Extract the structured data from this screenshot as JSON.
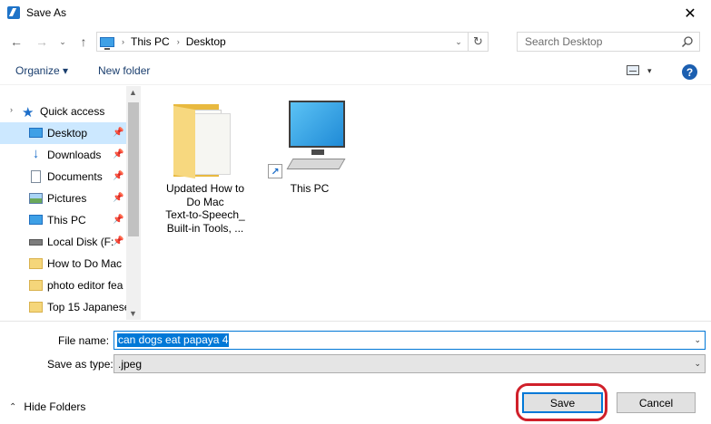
{
  "window": {
    "title": "Save As",
    "close_glyph": "✕"
  },
  "navigation": {
    "back_glyph": "←",
    "forward_glyph": "→",
    "recent_glyph": "⌄",
    "up_glyph": "↑",
    "breadcrumb_sep_glyph": "›",
    "breadcrumb": [
      "This PC",
      "Desktop"
    ],
    "address_dropdown_glyph": "⌄",
    "refresh_glyph": "↻",
    "search_placeholder": "Search Desktop"
  },
  "toolbar": {
    "organize_label": "Organize ▾",
    "new_folder_label": "New folder",
    "view_dropdown_glyph": "▾",
    "help_glyph": "?"
  },
  "nav_pane": {
    "quick_access_label": "Quick access",
    "expand_glyph": "›",
    "star_glyph": "★",
    "pin_glyph": "📌",
    "items": [
      {
        "label": "Desktop",
        "icon": "desktop-icon",
        "pinned": true,
        "selected": true
      },
      {
        "label": "Downloads",
        "icon": "downloads-icon",
        "pinned": true,
        "selected": false
      },
      {
        "label": "Documents",
        "icon": "documents-icon",
        "pinned": true,
        "selected": false
      },
      {
        "label": "Pictures",
        "icon": "pictures-icon",
        "pinned": true,
        "selected": false
      },
      {
        "label": "This PC",
        "icon": "this-pc-icon",
        "pinned": true,
        "selected": false
      },
      {
        "label": "Local Disk (F:",
        "icon": "local-disk-icon",
        "pinned": true,
        "selected": false
      },
      {
        "label": "How to Do Mac",
        "icon": "folder-icon",
        "pinned": false,
        "selected": false
      },
      {
        "label": "photo editor fea",
        "icon": "folder-icon",
        "pinned": false,
        "selected": false
      },
      {
        "label": "Top 15 Japanese",
        "icon": "folder-icon",
        "pinned": false,
        "selected": false
      }
    ],
    "scroll_up_glyph": "▲",
    "scroll_down_glyph": "▼"
  },
  "files": [
    {
      "label_lines": [
        "Updated How to",
        "Do Mac",
        "Text-to-Speech_",
        "Built-in Tools, ..."
      ],
      "icon": "folder-icon"
    },
    {
      "label_lines": [
        "This PC"
      ],
      "icon": "this-pc-shortcut-icon"
    }
  ],
  "form": {
    "file_name_label": "File name:",
    "file_name_value": "can dogs eat papaya 4",
    "save_as_type_label": "Save as type:",
    "save_as_type_value": ".jpeg",
    "dropdown_glyph": "⌄"
  },
  "footer": {
    "hide_folders_glyph": "⌃",
    "hide_folders_label": "Hide Folders",
    "save_label": "Save",
    "cancel_label": "Cancel"
  },
  "colors": {
    "selection_blue": "#0078d7",
    "nav_selected_bg": "#cce8ff",
    "highlight_ring": "#d0202a"
  }
}
